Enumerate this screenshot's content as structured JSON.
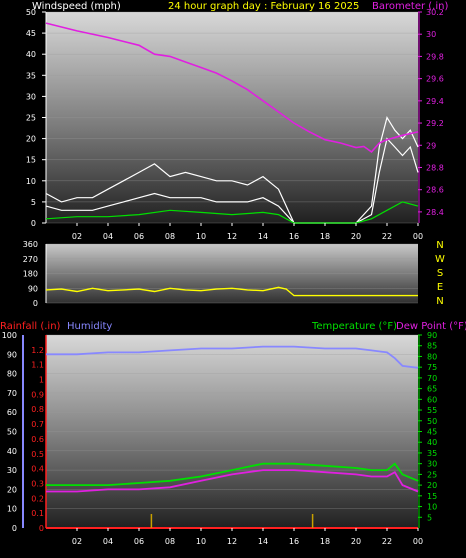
{
  "header": {
    "windspeed_label": "Windspeed (mph)",
    "title": "24 hour graph day : February 16 2025",
    "barometer_label": "Barometer (.in)"
  },
  "lower_header": {
    "rainfall_label": "Rainfall (.in)",
    "humidity_label": "Humidity",
    "temperature_label": "Temperature (°F)",
    "dewpoint_label": "Dew Point (°F)"
  },
  "colors": {
    "windspeed": "#ffffff",
    "wind_avg": "#00e000",
    "barometer": "#e020e0",
    "direction": "#ffff00",
    "rain": "#ff2020",
    "humidity": "#8888ff",
    "temperature": "#00e000",
    "dewpoint": "#e020e0",
    "title": "#ffff00"
  },
  "chart_data": [
    {
      "type": "line",
      "name": "wind-barometer",
      "x_ticks": [
        "02",
        "04",
        "06",
        "08",
        "10",
        "12",
        "14",
        "16",
        "18",
        "20",
        "22",
        "00"
      ],
      "ylabel": "Windspeed (mph)",
      "ylim": [
        0,
        50
      ],
      "y_ticks": [
        "0",
        "5",
        "10",
        "15",
        "20",
        "25",
        "30",
        "35",
        "40",
        "45",
        "50"
      ],
      "y2label": "Barometer (.in)",
      "y2lim": [
        28.3,
        30.2
      ],
      "y2_ticks": [
        "28.4",
        "28.6",
        "28.8",
        "29",
        "29.2",
        "29.4",
        "29.6",
        "29.8",
        "30",
        "30.2"
      ],
      "series": [
        {
          "name": "Windspeed (mph)",
          "color": "#ffffff",
          "x": [
            0,
            1,
            2,
            3,
            4,
            5,
            6,
            7,
            8,
            9,
            10,
            11,
            12,
            13,
            14,
            15,
            16,
            17,
            18,
            19,
            20,
            21,
            21.5,
            22,
            22.5,
            23,
            23.5,
            24
          ],
          "y": [
            4,
            3,
            3,
            3,
            4,
            5,
            6,
            7,
            6,
            6,
            6,
            5,
            5,
            5,
            6,
            4,
            0,
            0,
            0,
            0,
            0,
            2,
            12,
            20,
            18,
            16,
            18,
            12
          ]
        },
        {
          "name": "Wind Gust",
          "color": "#ffffff",
          "x": [
            0,
            1,
            2,
            3,
            4,
            5,
            6,
            7,
            8,
            9,
            10,
            11,
            12,
            13,
            14,
            15,
            16,
            17,
            18,
            19,
            20,
            21,
            21.5,
            22,
            22.5,
            23,
            23.5,
            24
          ],
          "y": [
            7,
            5,
            6,
            6,
            8,
            10,
            12,
            14,
            11,
            12,
            11,
            10,
            10,
            9,
            11,
            8,
            0,
            0,
            0,
            0,
            0,
            4,
            18,
            25,
            22,
            20,
            22,
            18
          ]
        },
        {
          "name": "Average",
          "color": "#00e000",
          "x": [
            0,
            2,
            4,
            6,
            8,
            10,
            12,
            14,
            15,
            16,
            20,
            21,
            22,
            23,
            24
          ],
          "y": [
            1,
            1.5,
            1.5,
            2,
            3,
            2.5,
            2,
            2.5,
            2,
            0,
            0,
            1,
            3,
            5,
            4
          ]
        },
        {
          "name": "Barometer (.in)",
          "axis": "right",
          "color": "#e020e0",
          "x": [
            0,
            2,
            4,
            6,
            7,
            8,
            9,
            10,
            11,
            12,
            13,
            14,
            15,
            16,
            17,
            18,
            19,
            20,
            20.5,
            21,
            21.5,
            22,
            23,
            24
          ],
          "y": [
            30.1,
            30.03,
            29.97,
            29.9,
            29.82,
            29.8,
            29.75,
            29.7,
            29.65,
            29.58,
            29.5,
            29.4,
            29.3,
            29.2,
            29.12,
            29.05,
            29.02,
            28.98,
            28.99,
            28.94,
            29.02,
            29.05,
            29.09,
            29.12
          ]
        }
      ]
    },
    {
      "type": "line",
      "name": "wind-direction",
      "x_ticks": [],
      "ylim": [
        0,
        360
      ],
      "y_ticks": [
        "0",
        "90",
        "180",
        "270",
        "360"
      ],
      "compass": [
        "N",
        "W",
        "S",
        "E",
        "N"
      ],
      "series": [
        {
          "name": "Direction",
          "color": "#ffff00",
          "x": [
            0,
            1,
            2,
            3,
            4,
            5,
            6,
            7,
            8,
            9,
            10,
            11,
            12,
            13,
            14,
            15,
            15.5,
            16,
            18,
            20,
            22,
            24
          ],
          "y": [
            80,
            85,
            70,
            90,
            75,
            80,
            85,
            70,
            90,
            80,
            75,
            85,
            90,
            80,
            75,
            95,
            85,
            45,
            45,
            45,
            45,
            45
          ]
        }
      ]
    },
    {
      "type": "line",
      "name": "rain-humidity-temperature",
      "x_ticks": [
        "02",
        "04",
        "06",
        "08",
        "10",
        "12",
        "14",
        "16",
        "18",
        "20",
        "22",
        "00"
      ],
      "ylim_humidity": [
        0,
        100
      ],
      "y_ticks_humidity": [
        "0",
        "10",
        "20",
        "30",
        "40",
        "50",
        "60",
        "70",
        "80",
        "90",
        "100"
      ],
      "ylim_rain": [
        0,
        1.3
      ],
      "y_ticks_rain": [
        "0",
        "0.1",
        "0.2",
        "0.3",
        "0.4",
        "0.5",
        "0.6",
        "0.7",
        "0.8",
        "0.9",
        "1",
        "1.1",
        "1.2"
      ],
      "ylim_temp": [
        0,
        90
      ],
      "y_ticks_temp": [
        "5",
        "10",
        "15",
        "20",
        "25",
        "30",
        "35",
        "40",
        "45",
        "50",
        "55",
        "60",
        "65",
        "70",
        "75",
        "80",
        "85",
        "90"
      ],
      "series": [
        {
          "name": "Humidity",
          "color": "#8888ff",
          "x": [
            0,
            2,
            4,
            6,
            8,
            10,
            12,
            14,
            16,
            18,
            20,
            21,
            22,
            22.5,
            23,
            24
          ],
          "y": [
            90,
            90,
            91,
            91,
            92,
            93,
            93,
            94,
            94,
            93,
            93,
            92,
            91,
            88,
            84,
            83
          ]
        },
        {
          "name": "Temperature (°F)",
          "color": "#00e000",
          "x": [
            0,
            2,
            4,
            6,
            8,
            10,
            12,
            14,
            16,
            18,
            20,
            21,
            22,
            22.5,
            23,
            24
          ],
          "y": [
            20,
            20,
            20,
            21,
            22,
            24,
            27,
            30,
            30,
            29,
            28,
            27,
            27,
            30,
            25,
            22
          ]
        },
        {
          "name": "Dew Point (°F)",
          "color": "#e020e0",
          "x": [
            0,
            2,
            4,
            6,
            8,
            10,
            12,
            14,
            16,
            18,
            20,
            21,
            22,
            22.5,
            23,
            24
          ],
          "y": [
            17,
            17,
            18,
            18,
            19,
            22,
            25,
            27,
            27,
            26,
            25,
            24,
            24,
            26,
            20,
            17
          ]
        },
        {
          "name": "Rainfall (.in)",
          "color": "#ff2020",
          "x": [
            0,
            24
          ],
          "y": [
            0,
            0
          ]
        }
      ],
      "markers": [
        {
          "x": 6.8,
          "color": "#c8a000"
        },
        {
          "x": 17.2,
          "color": "#c8a000"
        }
      ]
    }
  ]
}
